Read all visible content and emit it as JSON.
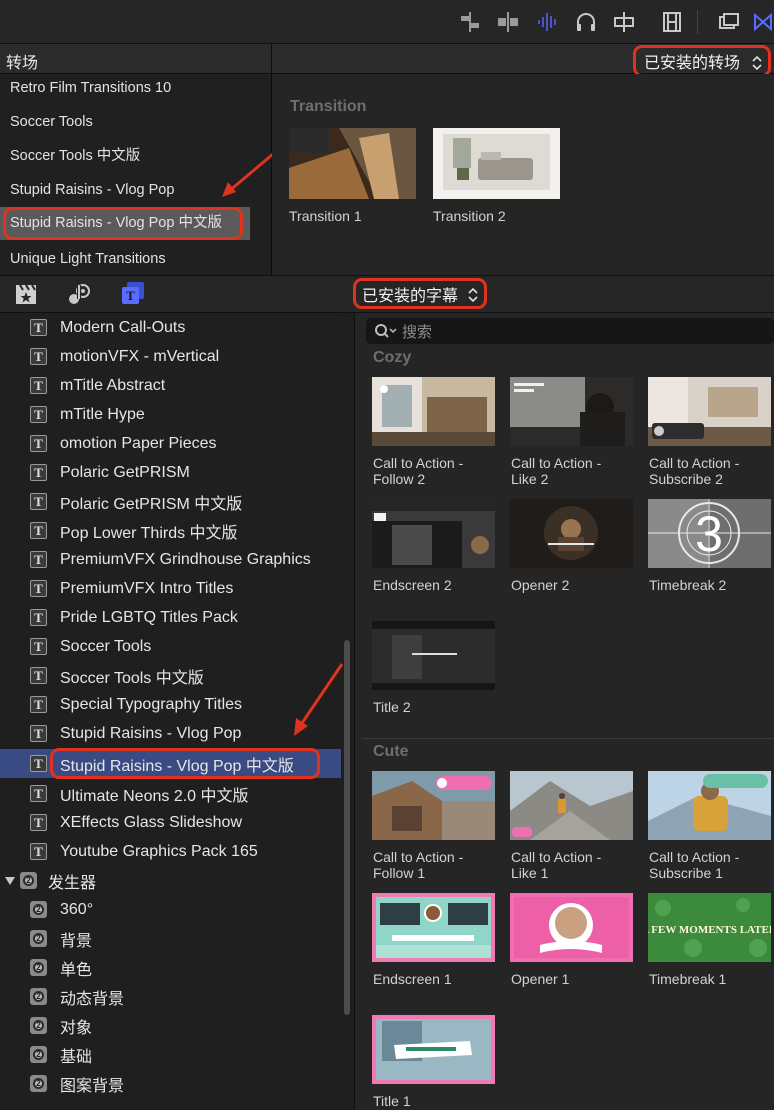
{
  "toolbar": {
    "icons": [
      "clip-connections-icon",
      "audio-split-icon",
      "waveform-icon",
      "headphones-icon",
      "skimming-icon",
      "filmstrip-icon",
      "window-icon",
      "transitions-browser-icon"
    ]
  },
  "transitions": {
    "title": "转场",
    "category_select": "已安装的转场",
    "list": [
      "Retro Film Transitions 10",
      "Soccer Tools",
      "Soccer Tools 中文版",
      "Stupid Raisins - Vlog Pop",
      "Stupid Raisins - Vlog Pop 中文版",
      "Unique Light Transitions"
    ],
    "selected_index": 4,
    "section_label": "Transition",
    "items": [
      "Transition 1",
      "Transition 2"
    ]
  },
  "titles": {
    "category_select": "已安装的字幕",
    "search_placeholder": "搜索",
    "list": [
      "Modern Call-Outs",
      "motionVFX - mVertical",
      "mTitle Abstract",
      "mTitle Hype",
      "omotion Paper Pieces",
      "Polaric GetPRISM",
      "Polaric GetPRISM 中文版",
      "Pop Lower Thirds 中文版",
      "PremiumVFX Grindhouse Graphics",
      "PremiumVFX Intro Titles",
      "Pride LGBTQ Titles Pack",
      "Soccer Tools",
      "Soccer Tools 中文版",
      "Special Typography Titles",
      "Stupid Raisins - Vlog Pop",
      "Stupid Raisins - Vlog Pop 中文版",
      "Ultimate Neons 2.0 中文版",
      "XEffects Glass Slideshow",
      "Youtube Graphics Pack 165"
    ],
    "selected_index": 15,
    "generators_label": "发生器",
    "generators": [
      "360°",
      "背景",
      "单色",
      "动态背景",
      "对象",
      "基础",
      "图案背景"
    ],
    "cozy_label": "Cozy",
    "cozy_items": [
      [
        "Call to Action -",
        "Follow 2"
      ],
      [
        "Call to Action -",
        "Like 2"
      ],
      [
        "Call to Action -",
        "Subscribe 2"
      ],
      [
        "Endscreen 2"
      ],
      [
        "Opener 2"
      ],
      [
        "Timebreak 2"
      ],
      [
        "Title 2"
      ]
    ],
    "cute_label": "Cute",
    "cute_items": [
      [
        "Call to Action -",
        "Follow 1"
      ],
      [
        "Call to Action -",
        "Like 1"
      ],
      [
        "Call to Action -",
        "Subscribe 1"
      ],
      [
        "Endscreen 1"
      ],
      [
        "Opener 1"
      ],
      [
        "Timebreak 1"
      ],
      [
        "Title 1"
      ]
    ],
    "timebreak_number": "3",
    "timebreak1_text": "A FEW MOMENTS LATER"
  },
  "colors": {
    "annotation": "#e0321f",
    "selected_row": "#3a4b84",
    "accent_icon": "#5a6cff"
  }
}
